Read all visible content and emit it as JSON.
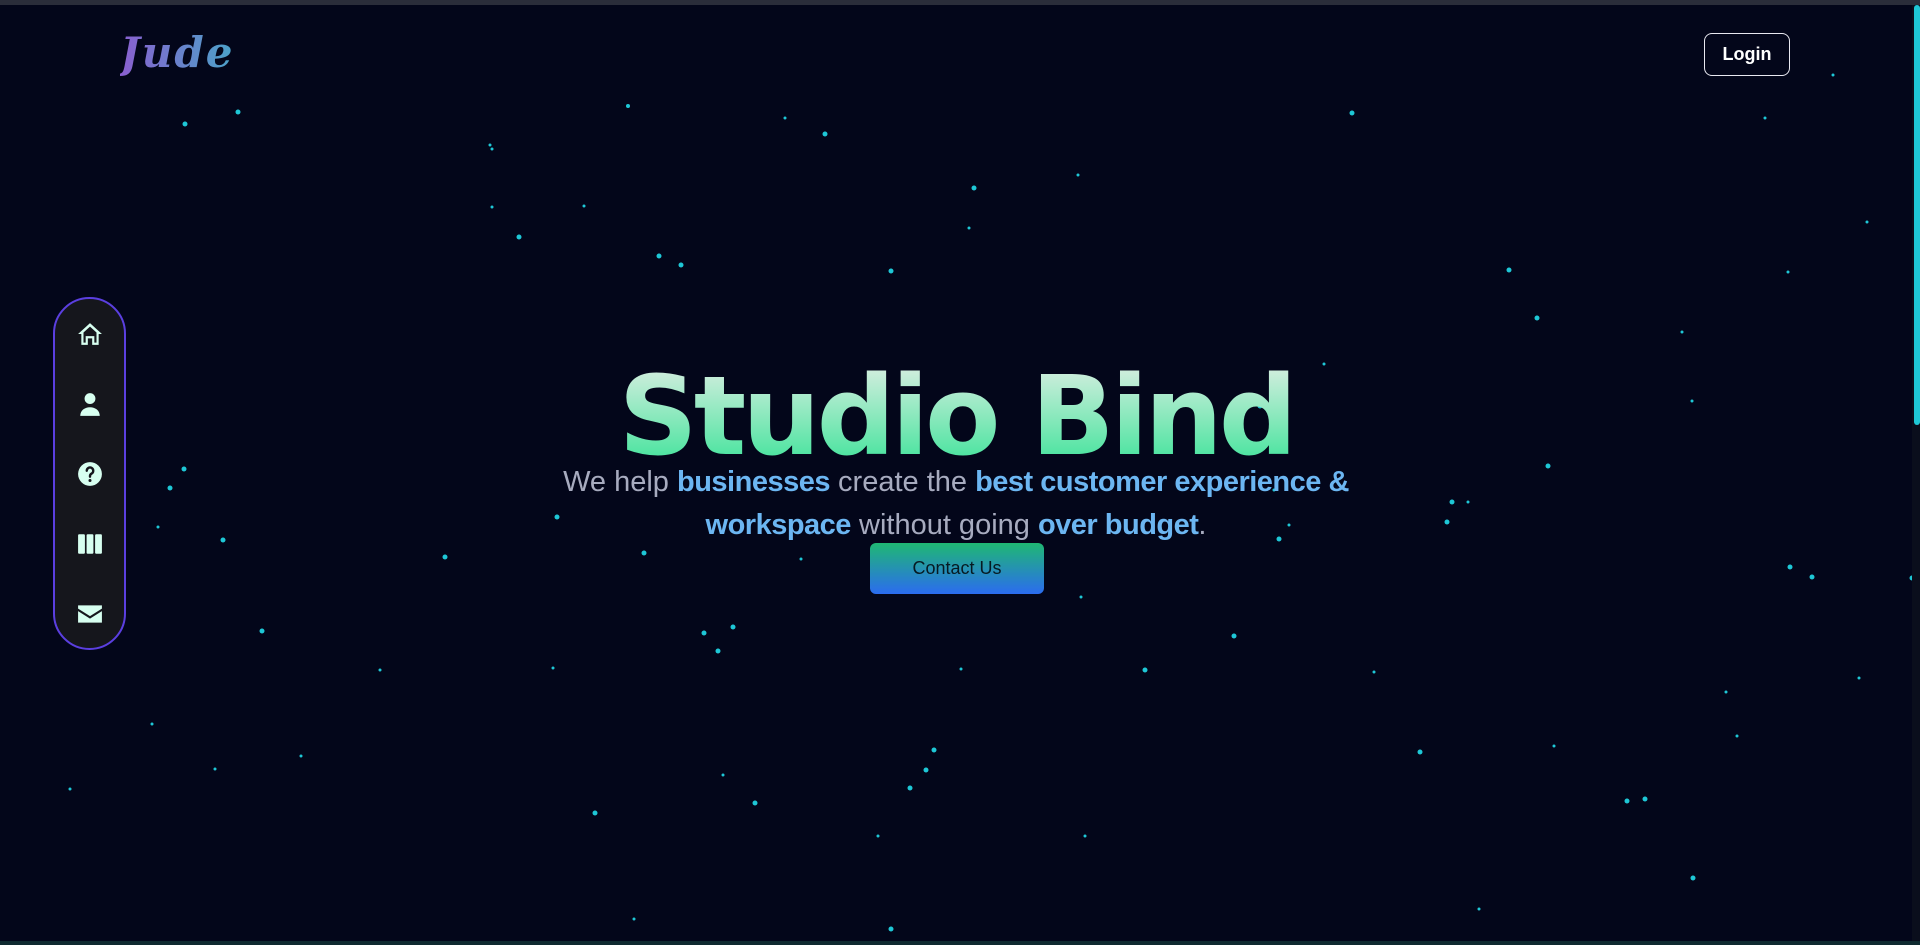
{
  "header": {
    "logo_text": "Jude",
    "login_label": "Login"
  },
  "side_nav": {
    "items": [
      {
        "icon": "home-icon",
        "label": "Home"
      },
      {
        "icon": "user-icon",
        "label": "About"
      },
      {
        "icon": "question-icon",
        "label": "FAQ"
      },
      {
        "icon": "columns-icon",
        "label": "Projects"
      },
      {
        "icon": "envelope-icon",
        "label": "Contact"
      }
    ]
  },
  "hero": {
    "title": "Studio Bind",
    "tagline": {
      "t1": "We help ",
      "h1": "businesses",
      "t2": " create the ",
      "h2": "best customer experience &",
      "h3": "workspace",
      "t3": " without going ",
      "h4": "over budget",
      "t4": "."
    },
    "cta_label": "Contact Us"
  },
  "colors": {
    "background": "#03061a",
    "star": "#1ec7d6",
    "accent_border": "#5b3fe0",
    "highlight_text": "#6cb6f2"
  }
}
